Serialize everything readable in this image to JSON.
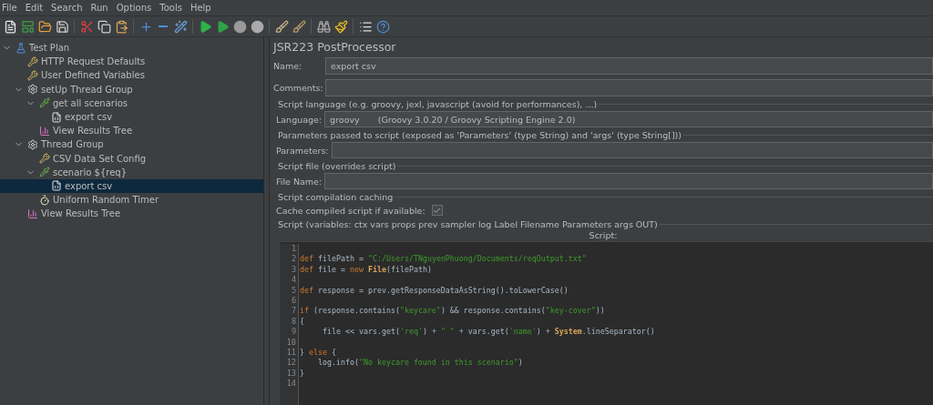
{
  "menu": [
    "File",
    "Edit",
    "Search",
    "Run",
    "Options",
    "Tools",
    "Help"
  ],
  "toolbar": [
    {
      "kind": "new"
    },
    {
      "kind": "templates"
    },
    {
      "kind": "open"
    },
    {
      "kind": "save"
    },
    {
      "kind": "sep"
    },
    {
      "kind": "cut"
    },
    {
      "kind": "copy"
    },
    {
      "kind": "paste"
    },
    {
      "kind": "sep"
    },
    {
      "kind": "expand"
    },
    {
      "kind": "collapse"
    },
    {
      "kind": "toggle"
    },
    {
      "kind": "sep"
    },
    {
      "kind": "start"
    },
    {
      "kind": "start-no-pause"
    },
    {
      "kind": "stop"
    },
    {
      "kind": "shutdown"
    },
    {
      "kind": "sep"
    },
    {
      "kind": "clear"
    },
    {
      "kind": "clear-all"
    },
    {
      "kind": "sep"
    },
    {
      "kind": "search"
    },
    {
      "kind": "reset-search"
    },
    {
      "kind": "sep"
    },
    {
      "kind": "functions"
    },
    {
      "kind": "help"
    }
  ],
  "tree": [
    {
      "label": "Test Plan",
      "kind": "plan",
      "expanded": true,
      "selected": false,
      "children": [
        {
          "label": "HTTP Request Defaults",
          "kind": "config",
          "selected": false
        },
        {
          "label": "User Defined Variables",
          "kind": "config",
          "selected": false
        },
        {
          "label": "setUp Thread Group",
          "kind": "threads",
          "expanded": true,
          "selected": false,
          "children": [
            {
              "label": "get all scenarios",
              "kind": "sampler",
              "expanded": true,
              "selected": false,
              "children": [
                {
                  "label": "export csv",
                  "kind": "postprocessor",
                  "selected": false
                }
              ]
            },
            {
              "label": "View Results Tree",
              "kind": "listener",
              "selected": false
            }
          ]
        },
        {
          "label": "Thread Group",
          "kind": "threads",
          "expanded": true,
          "selected": false,
          "children": [
            {
              "label": "CSV Data Set Config",
              "kind": "config",
              "selected": false
            },
            {
              "label": "scenario ${req}",
              "kind": "sampler",
              "expanded": true,
              "selected": false,
              "children": [
                {
                  "label": "export csv",
                  "kind": "postprocessor",
                  "selected": true
                }
              ]
            },
            {
              "label": "Uniform Random Timer",
              "kind": "timer",
              "selected": false
            }
          ]
        },
        {
          "label": "View Results Tree",
          "kind": "listener",
          "selected": false
        }
      ]
    }
  ],
  "panel": {
    "title": "JSR223 PostProcessor",
    "name": {
      "label": "Name:",
      "value": "export csv"
    },
    "comments": {
      "label": "Comments:"
    },
    "language_section": "Script language (e.g. groovy, jexl, javascript (avoid for performances), ...)",
    "language": {
      "label": "Language:",
      "value": "groovy",
      "detail": "(Groovy 3.0.20 / Groovy Scripting Engine 2.0)"
    },
    "parameters_section": "Parameters passed to script (exposed as 'Parameters' (type String) and 'args' (type String[]))",
    "parameters": {
      "label": "Parameters:"
    },
    "file_section": "Script file (overrides script)",
    "file_name": {
      "label": "File Name:"
    },
    "cache_section": "Script compilation caching",
    "cache": {
      "label": "Cache compiled script if available:",
      "checked": true
    },
    "script_section": "Script (variables: ctx vars props prev sampler log Label Filename Parameters args OUT)",
    "script_label": "Script:",
    "code": [
      {
        "number": "1"
      },
      {
        "number": "2",
        "tokens": [
          {
            "kind": "keyword",
            "text": "def"
          },
          {
            "kind": "plain",
            "text": " filePath = "
          },
          {
            "kind": "string",
            "text": "\"C:/Users/TNguyenPhuong/Documents/reqOutput.txt\""
          }
        ]
      },
      {
        "number": "3",
        "tokens": [
          {
            "kind": "keyword",
            "text": "def"
          },
          {
            "kind": "plain",
            "text": " file = "
          },
          {
            "kind": "keyword",
            "text": "new"
          },
          {
            "kind": "type",
            "text": " File"
          },
          {
            "kind": "plain",
            "text": "(filePath)"
          }
        ]
      },
      {
        "number": "4"
      },
      {
        "number": "5",
        "tokens": [
          {
            "kind": "keyword",
            "text": "def"
          },
          {
            "kind": "plain",
            "text": " response = prev.getResponseDataAsString().toLowerCase()"
          }
        ]
      },
      {
        "number": "6"
      },
      {
        "number": "7",
        "tokens": [
          {
            "kind": "keyword",
            "text": "if"
          },
          {
            "kind": "plain",
            "text": " (response.contains("
          },
          {
            "kind": "string",
            "text": "\"keycare\""
          },
          {
            "kind": "plain",
            "text": ") && response.contains("
          },
          {
            "kind": "string",
            "text": "\"key-cover\""
          },
          {
            "kind": "plain",
            "text": "))"
          }
        ]
      },
      {
        "number": "8",
        "tokens": [
          {
            "kind": "plain",
            "text": "{"
          }
        ]
      },
      {
        "number": "9",
        "tokens": [
          {
            "kind": "plain",
            "text": "     file << vars.get("
          },
          {
            "kind": "string",
            "text": "'req'"
          },
          {
            "kind": "plain",
            "text": ") + "
          },
          {
            "kind": "string",
            "text": "\" \""
          },
          {
            "kind": "plain",
            "text": " + vars.get("
          },
          {
            "kind": "string",
            "text": "'name'"
          },
          {
            "kind": "plain",
            "text": ") + "
          },
          {
            "kind": "type",
            "text": "System"
          },
          {
            "kind": "plain",
            "text": ".lineSeparator()"
          }
        ]
      },
      {
        "number": "10"
      },
      {
        "number": "11",
        "tokens": [
          {
            "kind": "plain",
            "text": "} "
          },
          {
            "kind": "keyword",
            "text": "else"
          },
          {
            "kind": "plain",
            "text": " {"
          }
        ]
      },
      {
        "number": "12",
        "tokens": [
          {
            "kind": "plain",
            "text": "    log.info("
          },
          {
            "kind": "string",
            "text": "\"No keycare found in this scenario\""
          },
          {
            "kind": "plain",
            "text": ")"
          }
        ]
      },
      {
        "number": "13",
        "tokens": [
          {
            "kind": "plain",
            "text": "}"
          }
        ]
      },
      {
        "number": "14"
      }
    ]
  }
}
